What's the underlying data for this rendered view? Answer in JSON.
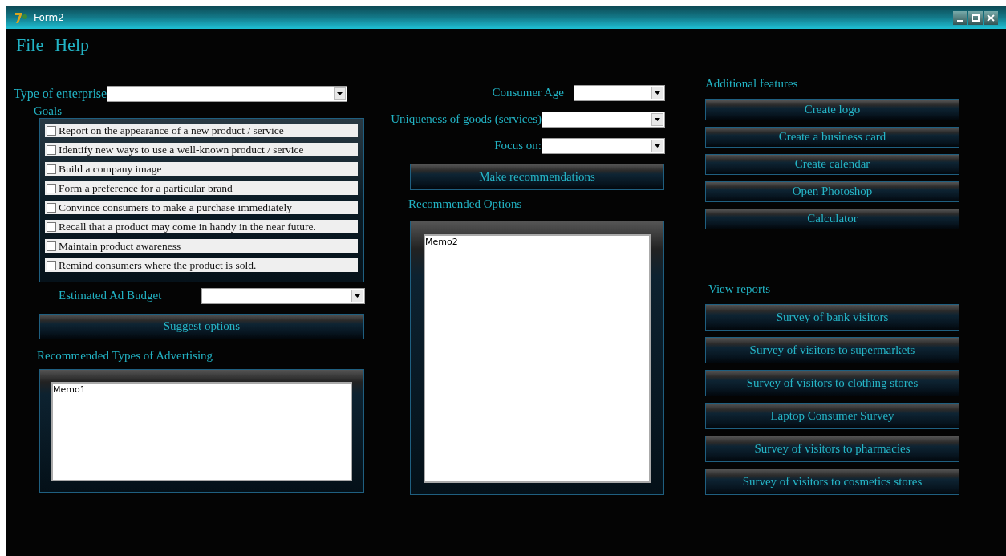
{
  "window": {
    "title": "Form2"
  },
  "menu": [
    "File",
    "Help"
  ],
  "enterprise": {
    "label": "Type of  enterprise"
  },
  "goals": {
    "label": "Goals",
    "items": [
      {
        "label": "Report on the appearance of  a new product / service",
        "checked": false
      },
      {
        "label": "Identify new ways to use a well-known product / service",
        "checked": false
      },
      {
        "label": "Build a company image",
        "checked": false
      },
      {
        "label": "Form a preference for a particular brand",
        "checked": false
      },
      {
        "label": "Convince consumers to make a purchase immediately",
        "checked": false
      },
      {
        "label": "Recall that a product may come in handy in the near future.",
        "checked": false
      },
      {
        "label": "Maintain product awareness",
        "checked": false
      },
      {
        "label": "Remind consumers where the product is sold.",
        "checked": false
      }
    ]
  },
  "budget": {
    "label": "Estimated Ad Budget"
  },
  "suggest_button": "Suggest options",
  "ad_types": {
    "label": "Recommended Types of  Advertising",
    "memo": "Memo1"
  },
  "criteria": [
    {
      "label": "Consumer Age"
    },
    {
      "label": "Uniqueness of  goods (services)"
    },
    {
      "label": "Focus on:"
    }
  ],
  "recommend_button": "Make recommendations",
  "options": {
    "label": "Recommended Options",
    "memo": "Memo2"
  },
  "additional_features": {
    "title": "Additional features",
    "buttons": [
      "Create logo",
      "Create a business card",
      "Create calendar",
      "Open Photoshop",
      "Calculator"
    ]
  },
  "view_reports": {
    "title": "View reports",
    "buttons": [
      "Survey of  bank visitors",
      "Survey of  visitors to supermarkets",
      "Survey of  visitors to clothing stores",
      "Laptop Consumer Survey",
      "Survey of  visitors to pharmacies",
      "Survey of  visitors to cosmetics stores"
    ]
  }
}
